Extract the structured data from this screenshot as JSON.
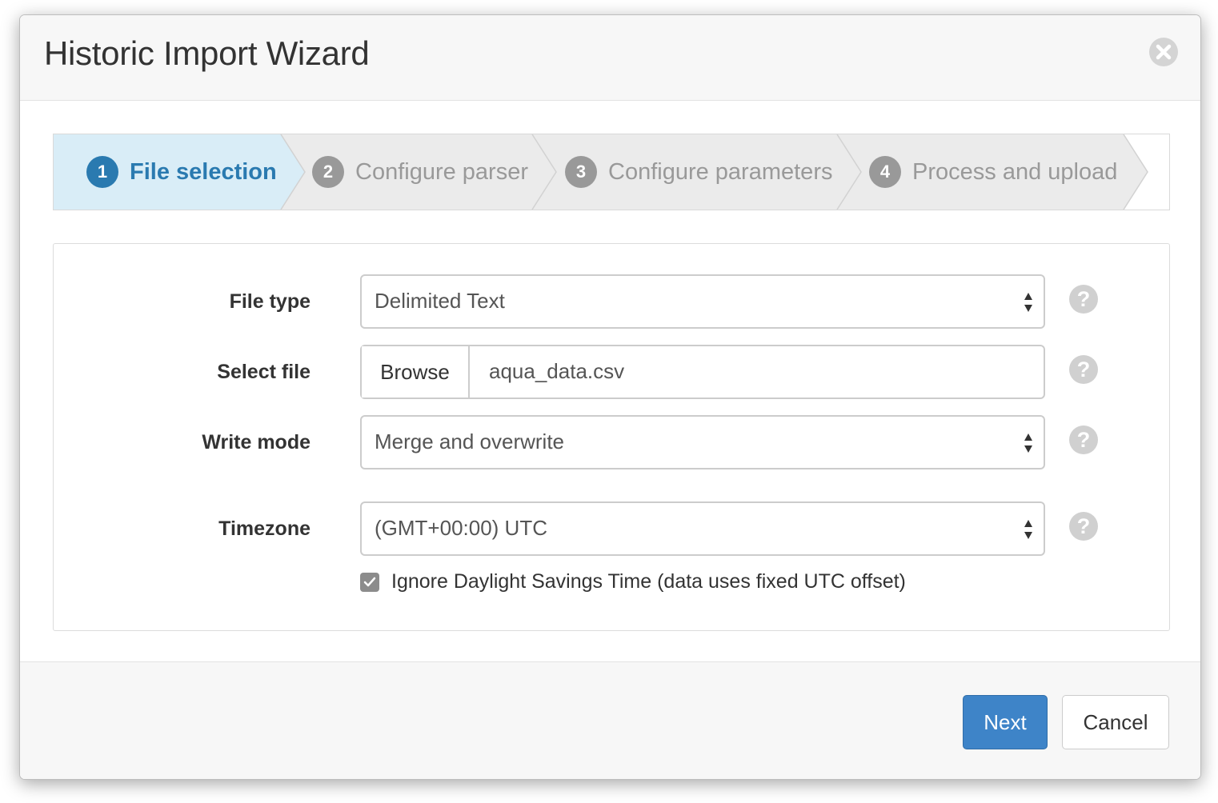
{
  "dialog": {
    "title": "Historic Import Wizard"
  },
  "stepper": {
    "steps": [
      {
        "number": "1",
        "label": "File selection",
        "state": "active"
      },
      {
        "number": "2",
        "label": "Configure parser",
        "state": "inactive"
      },
      {
        "number": "3",
        "label": "Configure parameters",
        "state": "inactive"
      },
      {
        "number": "4",
        "label": "Process and upload",
        "state": "inactive"
      }
    ],
    "active_color": "#2a7ab0",
    "active_bg": "#d9edf7"
  },
  "form": {
    "file_type": {
      "label": "File type",
      "value": "Delimited Text"
    },
    "select_file": {
      "label": "Select file",
      "browse_label": "Browse",
      "value": "aqua_data.csv"
    },
    "write_mode": {
      "label": "Write mode",
      "value": "Merge and overwrite"
    },
    "timezone": {
      "label": "Timezone",
      "value": "(GMT+00:00) UTC"
    },
    "ignore_dst": {
      "label": "Ignore Daylight Savings Time (data uses fixed UTC offset)",
      "checked": true
    },
    "help_glyph": "?"
  },
  "footer": {
    "next_label": "Next",
    "cancel_label": "Cancel",
    "primary_color": "#3e84c8"
  }
}
